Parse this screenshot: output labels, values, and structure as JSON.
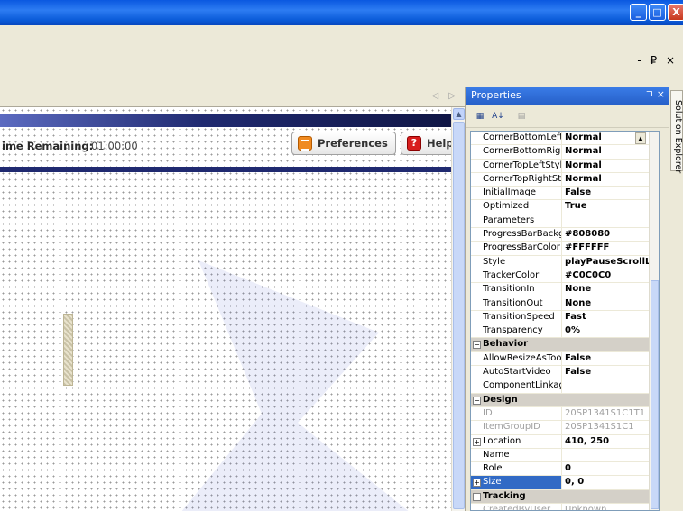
{
  "window": {
    "controls": {
      "minimize": "_",
      "maximize": "□",
      "close": "X"
    },
    "mdi_controls": "- ₽ ×"
  },
  "document": {
    "nav": "◁ ▷",
    "timer": {
      "label": "ime Remaining:",
      "value": "01:00:00"
    },
    "buttons": {
      "preferences": "Preferences",
      "help": "Help"
    },
    "colors": {
      "header_start": "#5c6bc0",
      "header_end": "#101645"
    }
  },
  "properties": {
    "title": "Properties",
    "pin": "⊐",
    "close": "×",
    "rows": [
      {
        "type": "prop",
        "name": "CornerBottomLeftSt",
        "value": "Normal"
      },
      {
        "type": "prop",
        "name": "CornerBottomRightS",
        "value": "Normal"
      },
      {
        "type": "prop",
        "name": "CornerTopLeftStyle",
        "value": "Normal"
      },
      {
        "type": "prop",
        "name": "CornerTopRightStyle",
        "value": "Normal"
      },
      {
        "type": "prop",
        "name": "InitialImage",
        "value": "False"
      },
      {
        "type": "prop",
        "name": "Optimized",
        "value": "True"
      },
      {
        "type": "prop",
        "name": "Parameters",
        "value": ""
      },
      {
        "type": "prop",
        "name": "ProgressBarBackgro",
        "value": "#808080"
      },
      {
        "type": "prop",
        "name": "ProgressBarColor",
        "value": "#FFFFFF"
      },
      {
        "type": "prop",
        "name": "Style",
        "value": "playPauseScrollLarg"
      },
      {
        "type": "prop",
        "name": "TrackerColor",
        "value": "#C0C0C0"
      },
      {
        "type": "prop",
        "name": "TransitionIn",
        "value": "None"
      },
      {
        "type": "prop",
        "name": "TransitionOut",
        "value": "None"
      },
      {
        "type": "prop",
        "name": "TransitionSpeed",
        "value": "Fast"
      },
      {
        "type": "prop",
        "name": "Transparency",
        "value": "0%"
      },
      {
        "type": "cat",
        "name": "Behavior"
      },
      {
        "type": "prop",
        "name": "AllowResizeAsTool",
        "value": "False"
      },
      {
        "type": "prop",
        "name": "AutoStartVideo",
        "value": "False"
      },
      {
        "type": "prop",
        "name": "ComponentLinkage",
        "value": ""
      },
      {
        "type": "cat",
        "name": "Design"
      },
      {
        "type": "ro",
        "name": "ID",
        "value": "20SP1341S1C1T1"
      },
      {
        "type": "ro",
        "name": "ItemGroupID",
        "value": "20SP1341S1C1"
      },
      {
        "type": "exp",
        "name": "Location",
        "value": "410, 250"
      },
      {
        "type": "prop",
        "name": "Name",
        "value": ""
      },
      {
        "type": "prop",
        "name": "Role",
        "value": "0"
      },
      {
        "type": "sel",
        "name": "Size",
        "value": "0, 0"
      },
      {
        "type": "cat",
        "name": "Tracking"
      },
      {
        "type": "ro",
        "name": "CreatedByUser",
        "value": "Unknown"
      }
    ]
  },
  "side_tab": {
    "label": "Solution Explorer"
  }
}
